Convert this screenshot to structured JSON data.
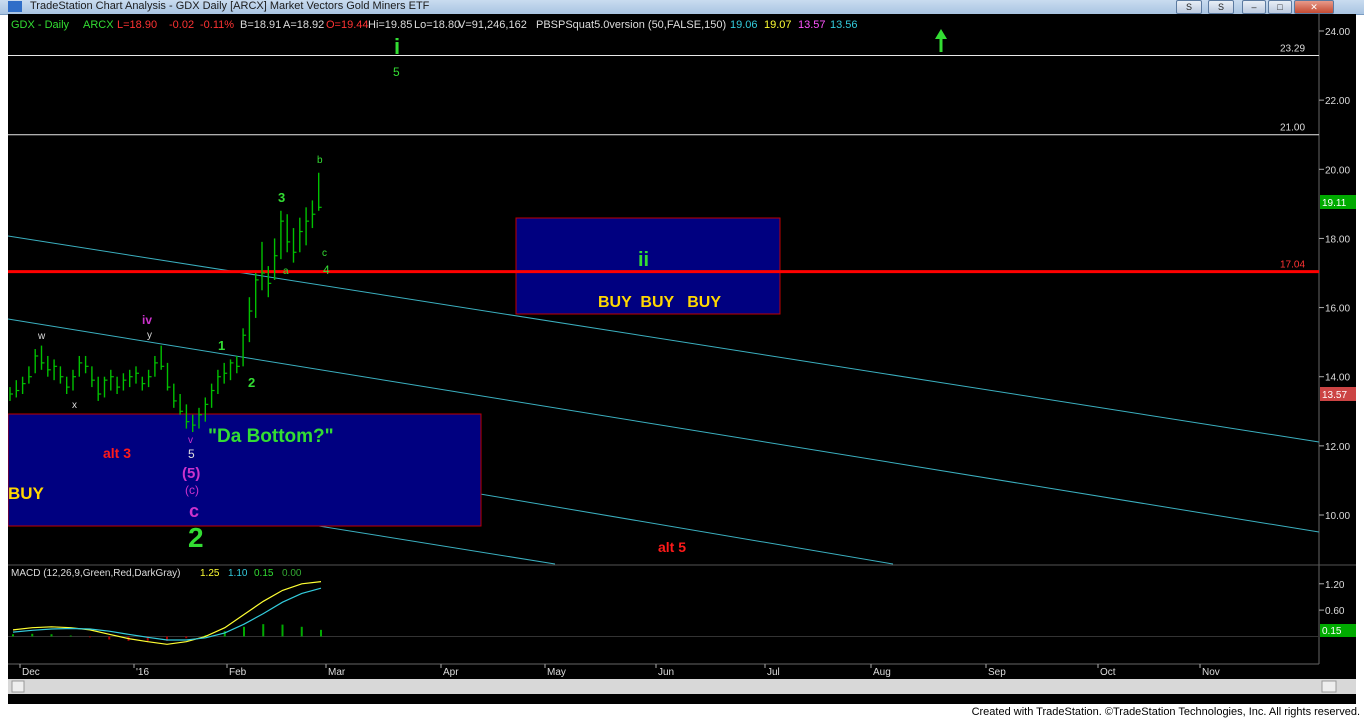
{
  "window": {
    "title": "TradeStation Chart Analysis - GDX Daily [ARCX] Market Vectors Gold Miners ETF",
    "btn_s": "S",
    "btn_min": "–",
    "btn_max": "□",
    "btn_close": "✕"
  },
  "header": {
    "symbol": "GDX - Daily",
    "exchange": "ARCX",
    "last": "L=18.90",
    "chg": "-0.02",
    "pct": "-0.11%",
    "bid": "B=18.91",
    "ask": "A=18.92",
    "open": "O=19.44",
    "hi": "Hi=19.85",
    "lo": "Lo=18.80",
    "vol": "V=91,246,162",
    "study": "PBSPSquat5.0version (50,FALSE,150)",
    "study_vals": [
      "19.06",
      "19.07",
      "13.57",
      "13.56"
    ]
  },
  "macd_header": {
    "label": "MACD (12,26,9,Green,Red,DarkGray)",
    "vals": [
      "1.25",
      "1.10",
      "0.15",
      "0.00"
    ]
  },
  "footer": "Created with TradeStation. ©TradeStation Technologies, Inc. All rights reserved.",
  "colors": {
    "bg": "#000000",
    "bar": "#00c000",
    "red_line": "#ff0000",
    "channel": "#3bb0c0",
    "box_fill": "#000080",
    "box_border": "#c00000",
    "label_green": "#33dd33",
    "label_magenta": "#cc33cc",
    "label_yellow": "#ffd700",
    "label_red": "#ff1a1a"
  },
  "chart_data": [
    {
      "type": "bar",
      "title": "GDX - Daily",
      "ylim": [
        9.3,
        24.4
      ],
      "y_ticks": [
        "24.00",
        "22.00",
        "20.00",
        "18.00",
        "16.00",
        "14.00",
        "12.00",
        "10.00"
      ],
      "x_ticks": [
        "Dec",
        "'16",
        "Feb",
        "Mar",
        "Apr",
        "May",
        "Jun",
        "Jul",
        "Aug",
        "Sep",
        "Oct",
        "Nov"
      ],
      "price_labels": {
        "last": "19.11",
        "study": "13.57"
      },
      "horizontal_lines": [
        {
          "label": "23.29",
          "value": 23.29,
          "color": "white"
        },
        {
          "label": "21.00",
          "value": 21.0,
          "color": "white"
        },
        {
          "label": "17.04",
          "value": 17.04,
          "color": "red"
        }
      ],
      "ohlc_approx": [
        [
          13.7,
          13.3,
          13.5
        ],
        [
          13.9,
          13.4,
          13.6
        ],
        [
          14.0,
          13.5,
          13.8
        ],
        [
          14.3,
          13.8,
          14.0
        ],
        [
          14.8,
          14.1,
          14.6
        ],
        [
          14.9,
          14.2,
          14.4
        ],
        [
          14.6,
          14.0,
          14.2
        ],
        [
          14.5,
          13.9,
          14.3
        ],
        [
          14.3,
          13.8,
          14.0
        ],
        [
          14.0,
          13.5,
          13.7
        ],
        [
          14.2,
          13.6,
          14.0
        ],
        [
          14.6,
          14.0,
          14.4
        ],
        [
          14.6,
          14.1,
          14.3
        ],
        [
          14.3,
          13.7,
          13.9
        ],
        [
          14.0,
          13.3,
          13.5
        ],
        [
          14.0,
          13.4,
          13.9
        ],
        [
          14.2,
          13.6,
          14.0
        ],
        [
          14.0,
          13.5,
          13.7
        ],
        [
          14.1,
          13.6,
          13.9
        ],
        [
          14.2,
          13.7,
          14.0
        ],
        [
          14.3,
          13.8,
          14.1
        ],
        [
          14.0,
          13.6,
          13.8
        ],
        [
          14.2,
          13.7,
          14.0
        ],
        [
          14.6,
          14.0,
          14.4
        ],
        [
          14.9,
          14.2,
          14.3
        ],
        [
          14.4,
          13.6,
          13.7
        ],
        [
          13.8,
          13.1,
          13.3
        ],
        [
          13.5,
          12.9,
          13.0
        ],
        [
          13.2,
          12.5,
          12.7
        ],
        [
          12.9,
          12.4,
          12.6
        ],
        [
          13.1,
          12.5,
          12.9
        ],
        [
          13.4,
          12.7,
          13.2
        ],
        [
          13.8,
          13.1,
          13.6
        ],
        [
          14.2,
          13.5,
          14.0
        ],
        [
          14.4,
          13.8,
          14.1
        ],
        [
          14.5,
          13.9,
          14.4
        ],
        [
          14.6,
          14.1,
          14.3
        ],
        [
          15.4,
          14.3,
          15.2
        ],
        [
          16.3,
          15.0,
          15.9
        ],
        [
          17.0,
          15.7,
          16.8
        ],
        [
          17.9,
          16.5,
          17.0
        ],
        [
          17.2,
          16.3,
          16.7
        ],
        [
          18.0,
          16.8,
          17.5
        ],
        [
          18.8,
          17.4,
          18.5
        ],
        [
          18.7,
          17.6,
          17.9
        ],
        [
          18.3,
          17.3,
          17.6
        ],
        [
          18.6,
          17.6,
          18.2
        ],
        [
          18.9,
          17.8,
          18.5
        ],
        [
          19.1,
          18.3,
          18.7
        ],
        [
          19.9,
          18.8,
          18.9
        ]
      ],
      "series": [],
      "wave_labels": [
        "i",
        "5",
        "b",
        "3",
        "c",
        "4",
        "a",
        "1",
        "2",
        "iv",
        "y",
        "w",
        "x",
        "v",
        "5",
        "(5)",
        "(c)",
        "c",
        "2",
        "ii",
        "alt 3",
        "alt 5"
      ],
      "annotations": [
        "\"Da Bottom?\"",
        "BUY  BUY   BUY",
        "BUY"
      ]
    },
    {
      "type": "line",
      "title": "MACD (12,26,9,Green,Red,DarkGray)",
      "ylim": [
        -0.4,
        1.4
      ],
      "y_ticks": [
        "1.20",
        "0.60"
      ],
      "price_label": "0.15",
      "series": [
        {
          "name": "MACD",
          "values": [
            0.15,
            0.2,
            0.22,
            0.2,
            0.15,
            0.05,
            -0.05,
            -0.12,
            -0.18,
            -0.12,
            0.0,
            0.2,
            0.5,
            0.8,
            1.05,
            1.2,
            1.25
          ]
        },
        {
          "name": "Avg",
          "values": [
            0.1,
            0.14,
            0.17,
            0.18,
            0.17,
            0.12,
            0.05,
            -0.02,
            -0.08,
            -0.08,
            -0.03,
            0.08,
            0.28,
            0.52,
            0.78,
            0.98,
            1.1
          ]
        },
        {
          "name": "Diff",
          "values": [
            0.05,
            0.06,
            0.05,
            0.02,
            -0.02,
            -0.07,
            -0.1,
            -0.1,
            -0.1,
            -0.04,
            0.03,
            0.12,
            0.22,
            0.28,
            0.27,
            0.22,
            0.15
          ]
        }
      ]
    }
  ]
}
